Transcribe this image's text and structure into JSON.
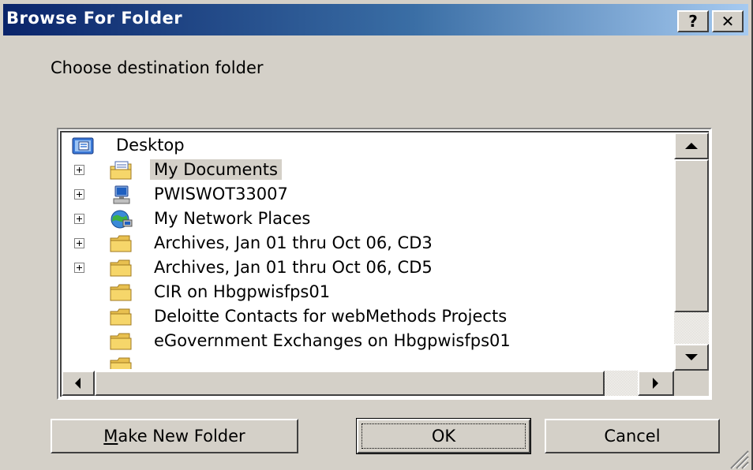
{
  "window": {
    "title": "Browse For Folder",
    "help_label": "?",
    "close_label": "✕"
  },
  "prompt": "Choose destination folder",
  "tree": {
    "items": [
      {
        "label": "Desktop",
        "icon": "desktop-icon",
        "expandable": false,
        "selected": false
      },
      {
        "label": "My Documents",
        "icon": "my-documents-icon",
        "expandable": true,
        "selected": true
      },
      {
        "label": "PWISWOT33007",
        "icon": "computer-icon",
        "expandable": true,
        "selected": false
      },
      {
        "label": "My Network Places",
        "icon": "network-places-icon",
        "expandable": true,
        "selected": false
      },
      {
        "label": "Archives, Jan 01 thru Oct 06, CD3",
        "icon": "folder-icon",
        "expandable": true,
        "selected": false
      },
      {
        "label": "Archives, Jan 01 thru Oct 06, CD5",
        "icon": "folder-icon",
        "expandable": true,
        "selected": false
      },
      {
        "label": "CIR on Hbgpwisfps01",
        "icon": "folder-icon",
        "expandable": false,
        "selected": false
      },
      {
        "label": "Deloitte Contacts for webMethods Projects",
        "icon": "folder-icon",
        "expandable": false,
        "selected": false
      },
      {
        "label": "eGovernment  Exchanges on Hbgpwisfps01",
        "icon": "folder-icon",
        "expandable": false,
        "selected": false
      }
    ]
  },
  "buttons": {
    "make_new_folder_mnemonic": "M",
    "make_new_folder_rest": "ake New Folder",
    "ok": "OK",
    "cancel": "Cancel"
  },
  "colors": {
    "title_gradient_start": "#0a246a",
    "title_gradient_end": "#a6caf0",
    "dialog_face": "#d4d0c8",
    "folder_yellow": "#f6d66a"
  }
}
